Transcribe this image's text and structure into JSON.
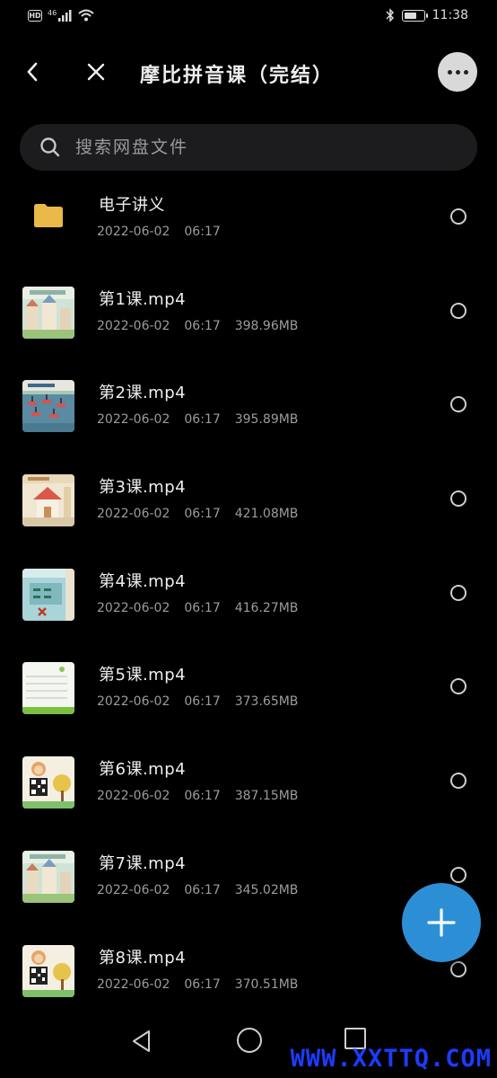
{
  "status": {
    "hd": "HD",
    "network": "46",
    "time": "11:38"
  },
  "header": {
    "title": "摩比拼音课（完结）"
  },
  "search": {
    "placeholder": "搜索网盘文件"
  },
  "files": [
    {
      "name": "电子讲义",
      "date": "2022-06-02",
      "time": "06:17",
      "size": "",
      "type": "folder"
    },
    {
      "name": "第1课.mp4",
      "date": "2022-06-02",
      "time": "06:17",
      "size": "398.96MB",
      "type": "video",
      "thumb": "rooftops"
    },
    {
      "name": "第2课.mp4",
      "date": "2022-06-02",
      "time": "06:17",
      "size": "395.89MB",
      "type": "video",
      "thumb": "boats"
    },
    {
      "name": "第3课.mp4",
      "date": "2022-06-02",
      "time": "06:17",
      "size": "421.08MB",
      "type": "video",
      "thumb": "house"
    },
    {
      "name": "第4课.mp4",
      "date": "2022-06-02",
      "time": "06:17",
      "size": "416.27MB",
      "type": "video",
      "thumb": "classroom"
    },
    {
      "name": "第5课.mp4",
      "date": "2022-06-02",
      "time": "06:17",
      "size": "373.65MB",
      "type": "video",
      "thumb": "lined-page"
    },
    {
      "name": "第6课.mp4",
      "date": "2022-06-02",
      "time": "06:17",
      "size": "387.15MB",
      "type": "video",
      "thumb": "qr-monkey"
    },
    {
      "name": "第7课.mp4",
      "date": "2022-06-02",
      "time": "06:17",
      "size": "345.02MB",
      "type": "video",
      "thumb": "rooftops"
    },
    {
      "name": "第8课.mp4",
      "date": "2022-06-02",
      "time": "06:17",
      "size": "370.51MB",
      "type": "video",
      "thumb": "qr-monkey"
    }
  ],
  "watermark": "WWW.XXTTQ.COM",
  "colors": {
    "background": "#000000",
    "fab": "#2c8fd6",
    "folder": "#e9b949",
    "watermark": "#1b3cff"
  }
}
